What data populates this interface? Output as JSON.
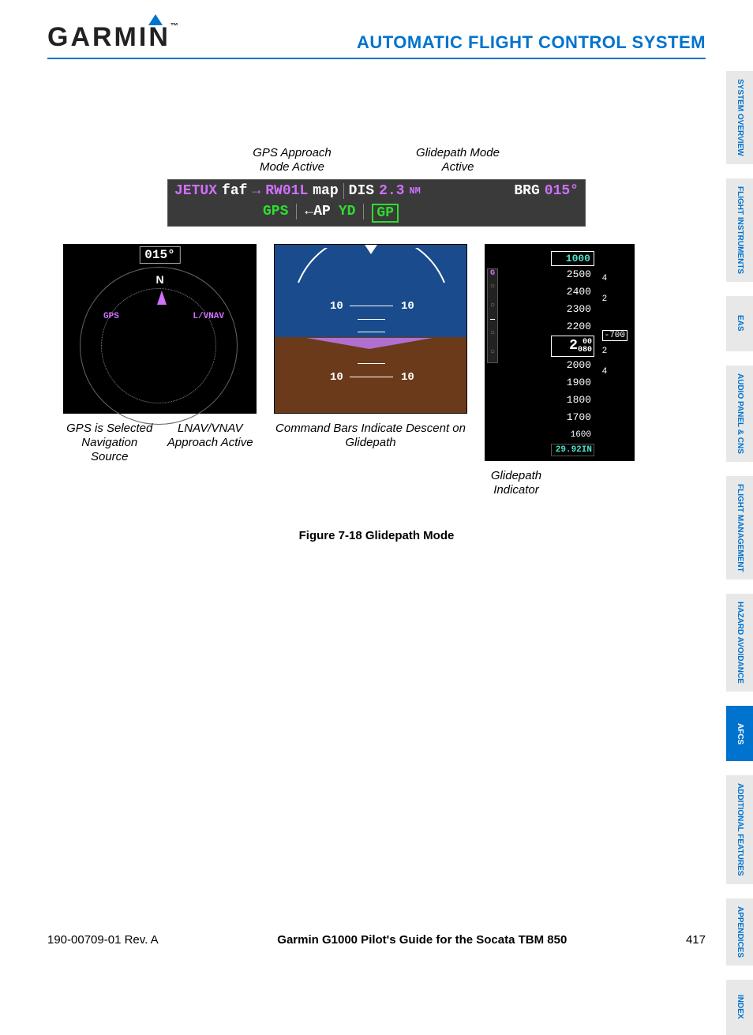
{
  "header": {
    "logo_text": "GARMIN",
    "section_title": "AUTOMATIC FLIGHT CONTROL SYSTEM"
  },
  "sidebar": [
    {
      "label": "SYSTEM OVERVIEW",
      "active": false
    },
    {
      "label": "FLIGHT INSTRUMENTS",
      "active": false
    },
    {
      "label": "EAS",
      "active": false
    },
    {
      "label": "AUDIO PANEL & CNS",
      "active": false
    },
    {
      "label": "FLIGHT MANAGEMENT",
      "active": false
    },
    {
      "label": "HAZARD AVOIDANCE",
      "active": false
    },
    {
      "label": "AFCS",
      "active": true
    },
    {
      "label": "ADDITIONAL FEATURES",
      "active": false
    },
    {
      "label": "APPENDICES",
      "active": false
    },
    {
      "label": "INDEX",
      "active": false
    }
  ],
  "callouts": {
    "gps_approach": "GPS Approach Mode Active",
    "glidepath_mode": "Glidepath Mode Active",
    "gps_selected": "GPS is Selected Navigation Source",
    "lnav_vnav": "LNAV/VNAV Approach Active",
    "command_bars": "Command Bars Indicate Descent on Glidepath",
    "glidepath_ind": "Glidepath Indicator"
  },
  "pfd_bar": {
    "wpt_from": "JETUX",
    "from_suffix": "faf",
    "arrow": "→",
    "wpt_to": "RW01L",
    "to_suffix": "map",
    "dis_label": "DIS",
    "dis_value": "2.3",
    "dis_unit": "NM",
    "brg_label": "BRG",
    "brg_value": "015°",
    "row2_gps": "GPS",
    "row2_ap": "←AP",
    "row2_yd": "YD",
    "row2_gp": "GP"
  },
  "hsi": {
    "heading": "015°",
    "north": "N",
    "nav_source": "GPS",
    "approach": "L/VNAV"
  },
  "adi": {
    "pitch_10_l": "10",
    "pitch_10_r": "10",
    "pitch_m10_l": "10",
    "pitch_m10_r": "10"
  },
  "alt_tape": {
    "selected": "1000",
    "ticks": [
      "2500",
      "2400",
      "2300",
      "2200"
    ],
    "current_large": "2",
    "current_small_top": "00",
    "current_small_mid": "080",
    "ticks_below": [
      "2000",
      "1900",
      "1800",
      "1700",
      "1600"
    ],
    "baro": "29.92IN",
    "vs_ticks": [
      "4",
      "2",
      "",
      "2",
      "4"
    ],
    "vs_value": "-700",
    "gp_letter": "G"
  },
  "figure_caption": "Figure 7-18  Glidepath Mode",
  "footer": {
    "doc_rev": "190-00709-01  Rev. A",
    "guide_title": "Garmin G1000 Pilot's Guide for the Socata TBM 850",
    "page": "417"
  }
}
